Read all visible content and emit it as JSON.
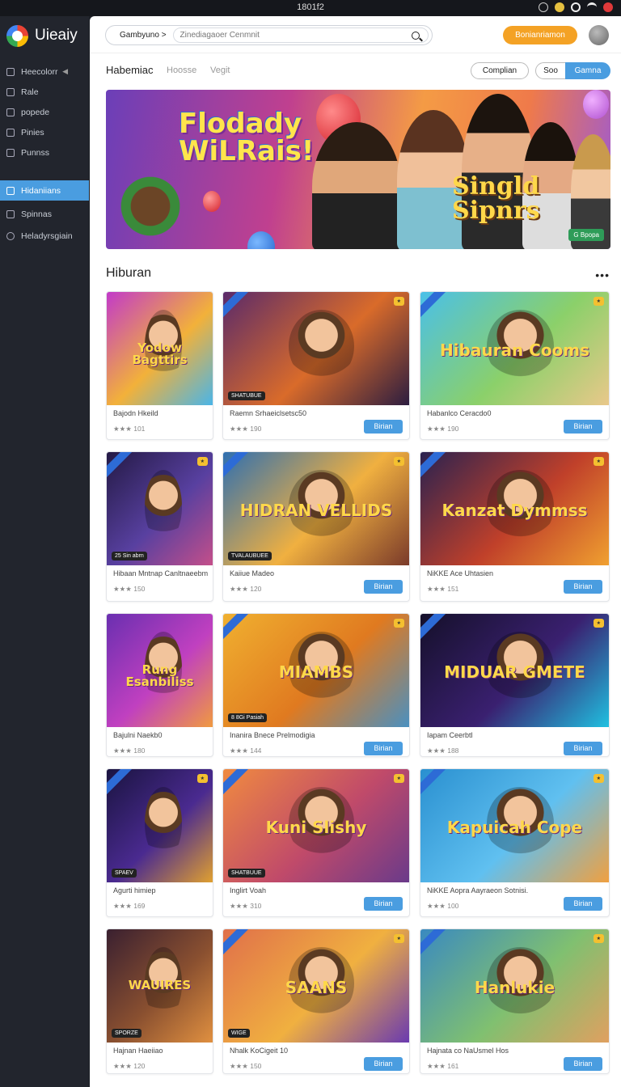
{
  "status": {
    "time": "1801f2"
  },
  "app": {
    "name": "Uieaiy"
  },
  "sidebar": {
    "items": [
      {
        "label": "Heecolorr",
        "icon": "home-icon"
      },
      {
        "label": "Rale",
        "icon": "page-icon"
      },
      {
        "label": "popede",
        "icon": "page-icon"
      },
      {
        "label": "Pinies",
        "icon": "list-icon"
      },
      {
        "label": "Punnss",
        "icon": "person-icon"
      },
      {
        "label": "Hidaniians",
        "icon": "grid-icon",
        "active": true
      },
      {
        "label": "Spinnas",
        "icon": "page-icon"
      },
      {
        "label": "Heladyrsgiain",
        "icon": "clock-icon"
      }
    ]
  },
  "topbar": {
    "search_category": "Gambyuno >",
    "search_placeholder": "Zinediagaoer Cenmnit",
    "cta_label": "Bonianriamon"
  },
  "tabs": [
    "Habemiac",
    "Hoosse",
    "Vegit"
  ],
  "filters": {
    "compare": "Complian",
    "so": "Soo",
    "games": "Gamna"
  },
  "hero": {
    "title_line1": "Flodady",
    "title_line2": "WiLRais!",
    "subtitle_line1": "Singld",
    "subtitle_line2": "Sipnrs",
    "tag": "G Bpopa"
  },
  "section": {
    "title": "Hiburan"
  },
  "cards": [
    {
      "name": "Bajodn Hkeild",
      "meta": "★★★ 101",
      "thumb_title": "Yodow Bagttirs",
      "button": ""
    },
    {
      "name": "Raemn Srhaeiclsetsc50",
      "meta": "★★★ 190",
      "thumb_title": "",
      "thumb_label": "SHATUBUE",
      "button": "Birian"
    },
    {
      "name": "Habanlco Ceracdo0",
      "meta": "★★★ 190",
      "thumb_title": "Hibauran Cooms",
      "button": "Birian"
    },
    {
      "name": "Hibaan Mntnap Canltnaeebm",
      "meta": "★★★ 150",
      "thumb_title": "",
      "thumb_label": "25 Sin abrn",
      "button": ""
    },
    {
      "name": "Kaiiue Madeo",
      "meta": "★★★ 120",
      "thumb_title": "HIDRAN VELLIDS",
      "thumb_label": "TVALAUBUEE",
      "button": "Birian"
    },
    {
      "name": "NiKKE Ace Uhtasien",
      "meta": "★★★ 151",
      "thumb_title": "Kanzat Dymmss",
      "button": "Birian"
    },
    {
      "name": "Bajulni Naekb0",
      "meta": "★★★ 180",
      "thumb_title": "Rung Esanbiliss",
      "button": ""
    },
    {
      "name": "Inanira Bnece Prelmodigia",
      "meta": "★★★ 144",
      "thumb_title": "MIAMBS",
      "thumb_label": "8 8Gi Pasiah",
      "button": "Birian"
    },
    {
      "name": "Iapam Ceerbtl",
      "meta": "★★★ 188",
      "thumb_title": "MIDUAR GMETE",
      "button": "Birian"
    },
    {
      "name": "Agurti himiep",
      "meta": "★★★ 169",
      "thumb_title": "",
      "thumb_label": "SPAEV",
      "button": ""
    },
    {
      "name": "Inglirt Voah",
      "meta": "★★★ 310",
      "thumb_title": "Kuni Slishy",
      "thumb_label": "SHATBUUE",
      "button": "Birian"
    },
    {
      "name": "NiKKE Aopra Aayraeon Sotnisi.",
      "meta": "★★★ 100",
      "thumb_title": "Kapuicah Cope",
      "button": "Birian"
    },
    {
      "name": "Hajnan Haeiiao",
      "meta": "★★★ 120",
      "thumb_title": "WAUIRES",
      "thumb_label": "SPORZE",
      "button": ""
    },
    {
      "name": "Nhalk KoCigeit 10",
      "meta": "★★★ 150",
      "thumb_title": "SAANS",
      "thumb_label": "WIGE",
      "button": "Birian"
    },
    {
      "name": "Hajnata co NaUsmel Hos",
      "meta": "★★★ 161",
      "thumb_title": "Hanlukie",
      "button": "Birian"
    }
  ],
  "colors": {
    "accent": "#4a9de0",
    "cta": "#f4a225",
    "sidebar": "#22252d"
  }
}
